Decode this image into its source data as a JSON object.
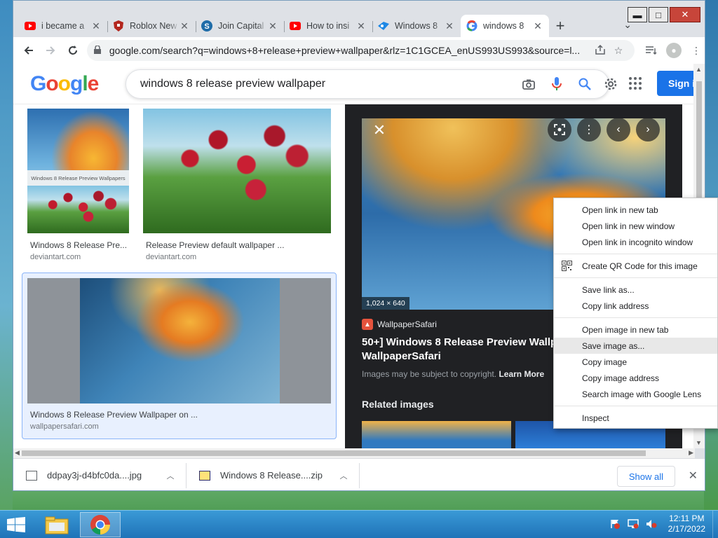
{
  "window": {
    "minimize": "▬",
    "maximize": "□",
    "close": "✕"
  },
  "tabs": [
    {
      "title": "i became a",
      "favicon": "youtube-icon",
      "active": false
    },
    {
      "title": "Roblox New",
      "favicon": "shield-icon",
      "active": false
    },
    {
      "title": "Join Capital",
      "favicon": "s-logo-icon",
      "active": false
    },
    {
      "title": "How to insi",
      "favicon": "youtube-icon",
      "active": false
    },
    {
      "title": "Windows 8",
      "favicon": "windows-blue-icon",
      "active": false
    },
    {
      "title": "windows 8",
      "favicon": "google-icon",
      "active": true
    }
  ],
  "toolbar": {
    "url": "google.com/search?q=windows+8+release+preview+wallpaper&rlz=1C1GCEA_enUS993US993&source=l..."
  },
  "google": {
    "logo_letters": [
      "G",
      "o",
      "o",
      "g",
      "l",
      "e"
    ],
    "query": "windows 8 release preview wallpaper",
    "signin": "Sign i"
  },
  "results": [
    {
      "caption": "Windows 8 Release Pre...",
      "source": "deviantart.com",
      "overlay_text": "Windows 8 Release Preview Wallpapers"
    },
    {
      "caption": "Release Preview default wallpaper ...",
      "source": "deviantart.com"
    },
    {
      "caption": "Windows 8 Release Preview Wallpaper on ...",
      "source": "wallpapersafari.com"
    }
  ],
  "preview": {
    "dims": "1,024 × 640",
    "site": "WallpaperSafari",
    "title_line1": "50+] Windows 8 Release Preview Wallpap",
    "title_line2": "WallpaperSafari",
    "copyright": "Images may be subject to copyright.",
    "learn_more": "Learn More",
    "related": "Related images"
  },
  "context_menu": [
    "Open link in new tab",
    "Open link in new window",
    "Open link in incognito window",
    "Create QR Code for this image",
    "Save link as...",
    "Copy link address",
    "Open image in new tab",
    "Save image as...",
    "Copy image",
    "Copy image address",
    "Search image with Google Lens",
    "Inspect"
  ],
  "downloads": [
    {
      "name": "ddpay3j-d4bfc0da....jpg"
    },
    {
      "name": "Windows 8 Release....zip"
    }
  ],
  "shelf": {
    "show_all": "Show all"
  },
  "taskbar": {
    "time": "12:11 PM",
    "date": "2/17/2022"
  }
}
